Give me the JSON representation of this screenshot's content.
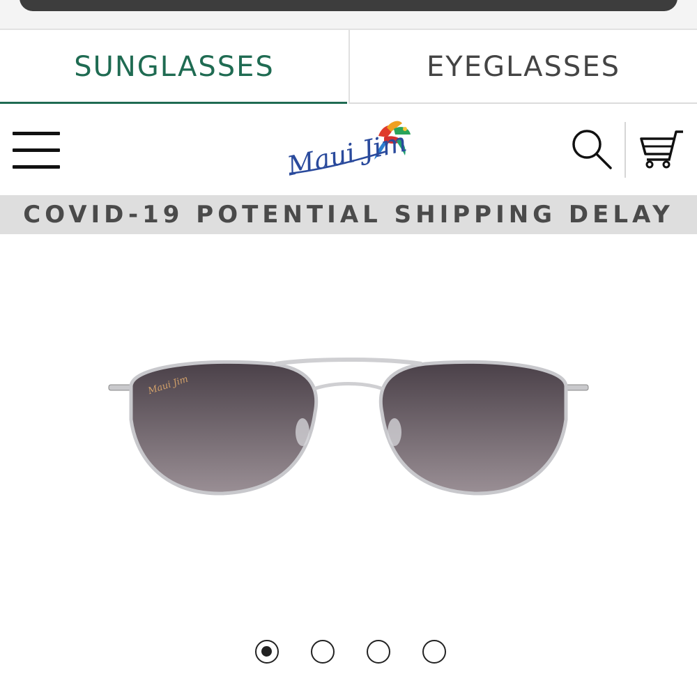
{
  "tabs": [
    {
      "label": "SUNGLASSES",
      "active": true
    },
    {
      "label": "EYEGLASSES",
      "active": false
    }
  ],
  "header": {
    "menu_icon": "hamburger-menu-icon",
    "logo_text": "Maui Jim",
    "search_icon": "search-icon",
    "cart_icon": "shopping-cart-icon"
  },
  "banner": {
    "text": "COVID-19 POTENTIAL SHIPPING DELAY"
  },
  "product": {
    "image_alt": "aviator-sunglasses",
    "temple_logo_text": "Maui Jim"
  },
  "carousel": {
    "total": 4,
    "active_index": 0
  },
  "colors": {
    "accent_green": "#1f6b52",
    "banner_bg": "#dedede",
    "banner_text": "#4a4a4a",
    "logo_blue": "#2a4a9c"
  }
}
